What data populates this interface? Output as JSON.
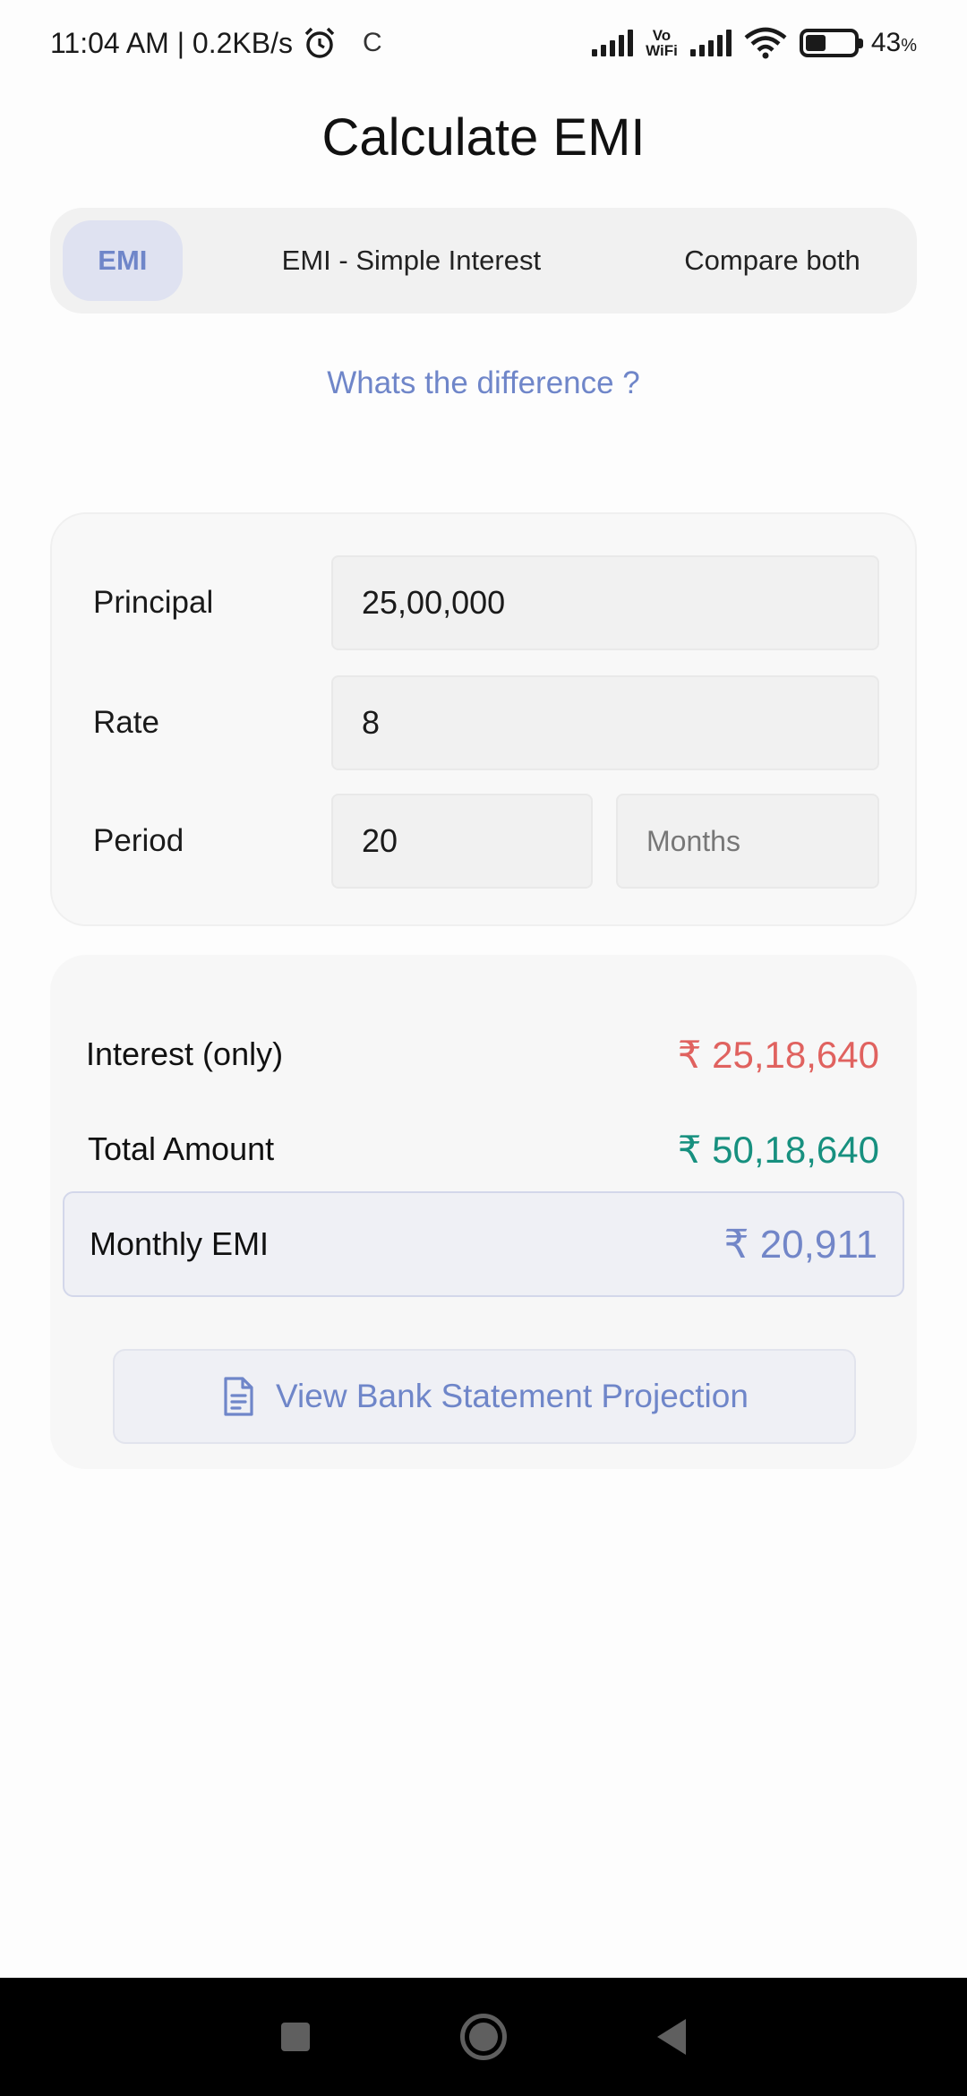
{
  "status_bar": {
    "time_speed": "11:04 AM | 0.2KB/s",
    "indicator_c": "C",
    "vowifi_top": "Vo",
    "vowifi_bottom": "WiFi",
    "battery_percent": "43",
    "battery_unit": "%",
    "battery_level": 0.43
  },
  "header": {
    "title": "Calculate EMI"
  },
  "tabs": {
    "selected": "EMI",
    "items": [
      {
        "label": "EMI"
      },
      {
        "label": "EMI - Simple Interest"
      },
      {
        "label": "Compare both"
      }
    ]
  },
  "difference_link": "Whats the difference ?",
  "inputs": {
    "principal": {
      "label": "Principal",
      "value": "25,00,000"
    },
    "rate": {
      "label": "Rate",
      "value": "8"
    },
    "period": {
      "label": "Period",
      "value": "20",
      "unit_placeholder": "Months"
    }
  },
  "results": {
    "interest": {
      "label": "Interest (only)",
      "value": "₹ 25,18,640"
    },
    "total": {
      "label": "Total Amount",
      "value": "₹ 50,18,640"
    },
    "monthly_emi": {
      "label": "Monthly EMI",
      "value": "₹ 20,911"
    }
  },
  "projection_button": {
    "label": "View Bank Statement Projection",
    "icon": "document-icon"
  },
  "colors": {
    "accent": "#6f86c9",
    "interest_red": "#e0625f",
    "total_teal": "#17907f"
  }
}
